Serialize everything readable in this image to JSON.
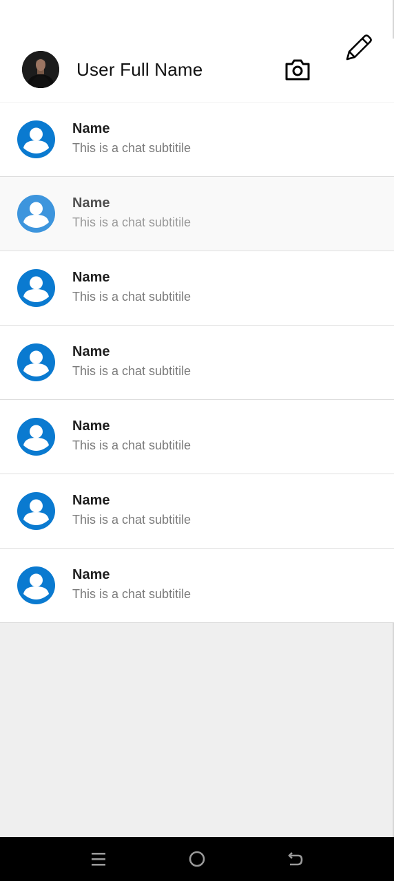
{
  "header": {
    "title": "User Full Name",
    "profile_avatar": "profile-photo",
    "actions": [
      {
        "icon": "camera-icon"
      },
      {
        "icon": "pencil-icon"
      }
    ]
  },
  "chats": [
    {
      "name": "Name",
      "subtitle": "This is a chat subtitile",
      "icon": "person-icon",
      "pressed": false
    },
    {
      "name": "Name",
      "subtitle": "This is a chat subtitile",
      "icon": "person-icon",
      "pressed": true
    },
    {
      "name": "Name",
      "subtitle": "This is a chat subtitile",
      "icon": "person-icon",
      "pressed": false
    },
    {
      "name": "Name",
      "subtitle": "This is a chat subtitile",
      "icon": "person-icon",
      "pressed": false
    },
    {
      "name": "Name",
      "subtitle": "This is a chat subtitile",
      "icon": "person-icon",
      "pressed": false
    },
    {
      "name": "Name",
      "subtitle": "This is a chat subtitile",
      "icon": "person-icon",
      "pressed": false
    },
    {
      "name": "Name",
      "subtitle": "This is a chat subtitile",
      "icon": "person-icon",
      "pressed": false
    }
  ],
  "navbar": {
    "buttons": [
      {
        "icon": "recent-apps-icon"
      },
      {
        "icon": "home-icon"
      },
      {
        "icon": "back-icon"
      }
    ]
  },
  "colors": {
    "accent": "#0a7ad0",
    "accent_pressed": "#3d95dd",
    "background": "#efefef"
  }
}
